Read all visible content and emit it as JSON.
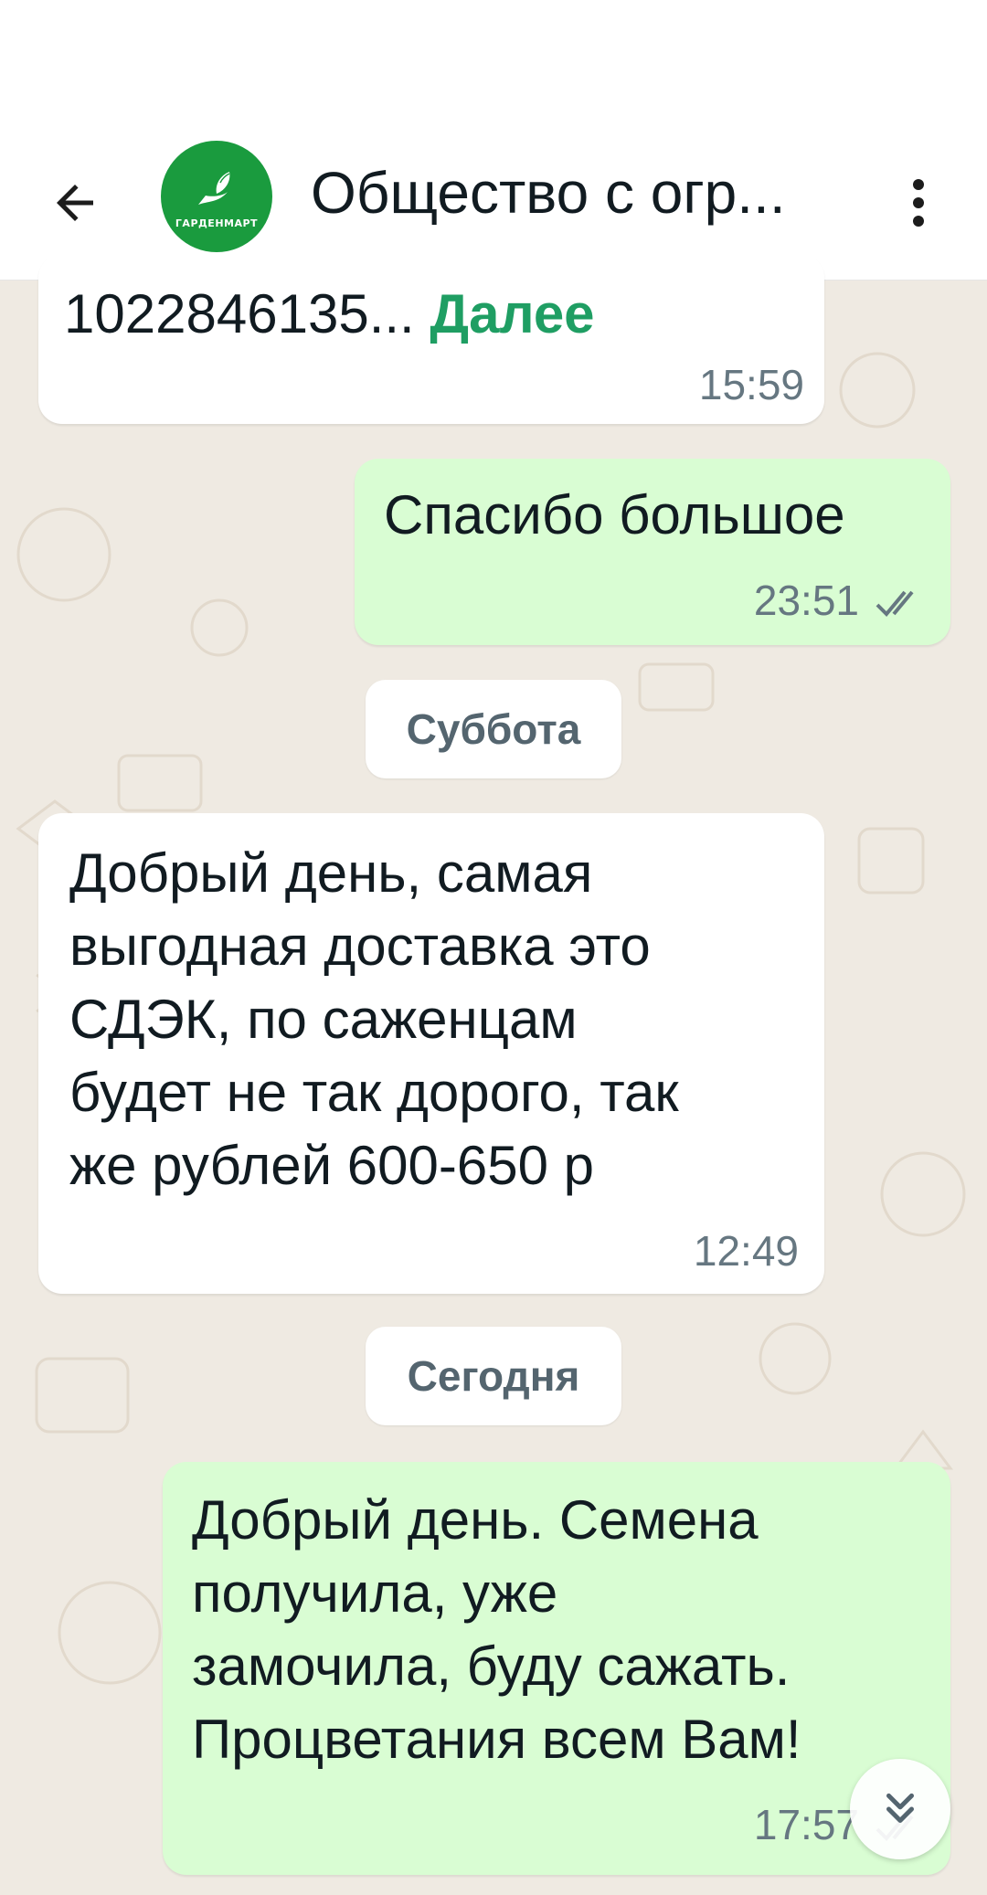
{
  "header": {
    "title": "Общество с огр...",
    "avatar_text": "ГАРДЕНМАРТ"
  },
  "messages": [
    {
      "direction": "in",
      "text": "1022846135...",
      "more": "Далее",
      "time": "15:59"
    },
    {
      "direction": "out",
      "text": "Спасибо большое",
      "time": "23:51",
      "status": "read"
    },
    {
      "direction": "in",
      "lines": [
        "Добрый день, самая",
        "выгодная доставка это",
        "СДЭК, по саженцам",
        "будет не так дорого, так",
        "же рублей 600-650 р"
      ],
      "time": "12:49"
    },
    {
      "direction": "out",
      "lines": [
        "Добрый день. Семена",
        "получила, уже",
        "замочила, буду сажать.",
        "Процветания всем Вам!"
      ],
      "time": "17:57",
      "status": "read"
    }
  ],
  "date_separators": [
    "Суббота",
    "Сегодня"
  ],
  "colors": {
    "brand": "#1a9b3e",
    "outgoing_bubble": "#d9fdd3",
    "incoming_bubble": "#ffffff",
    "chat_background": "#efeae2",
    "read_check": "#667781",
    "link": "#1f9e63"
  },
  "icons": {
    "back": "arrow-left-icon",
    "menu": "more-vertical-icon",
    "scroll_down": "chevron-double-down-icon",
    "read": "double-check-icon"
  }
}
